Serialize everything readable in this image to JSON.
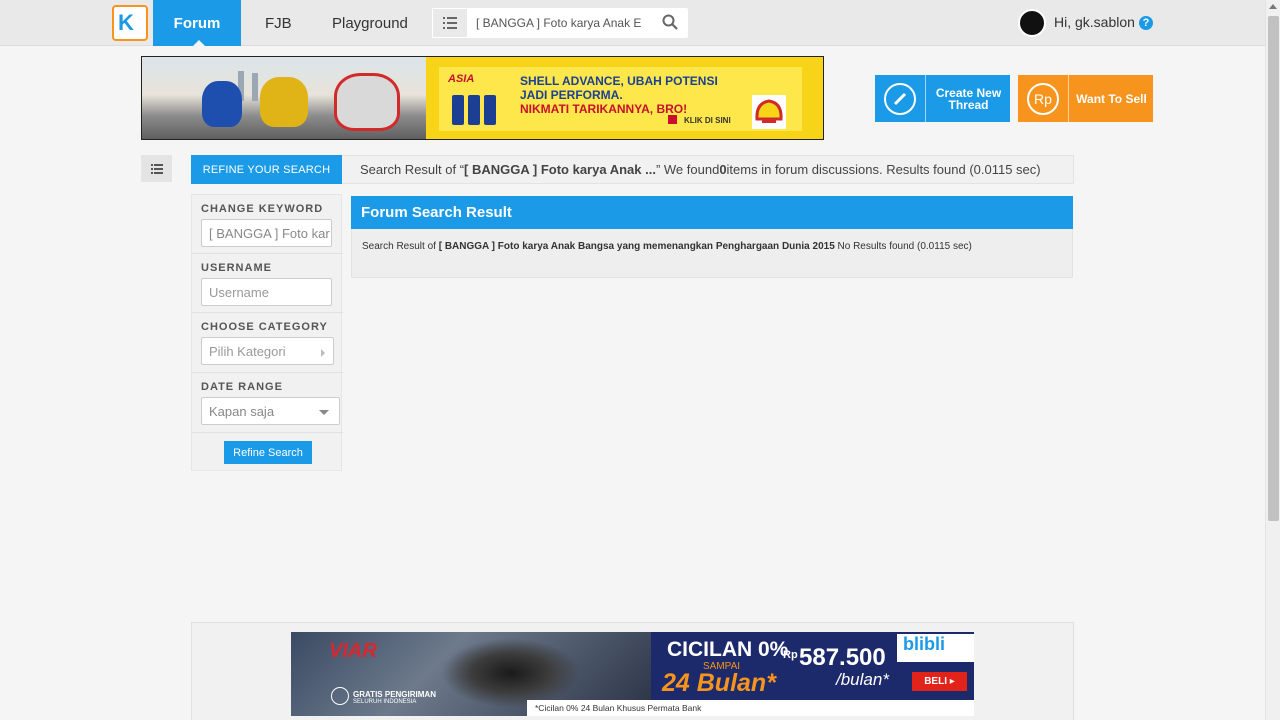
{
  "nav": {
    "logo_letter": "K",
    "forum": "Forum",
    "fjb": "FJB",
    "playground": "Playground",
    "search_value": "[ BANGGA ] Foto karya Anak E",
    "greeting": "Hi, gk.sablon",
    "help": "?"
  },
  "top_banner": {
    "cup_text": "ASIA",
    "line1": "SHELL ADVANCE, UBAH POTENSI",
    "line2": "JADI PERFORMA.",
    "line3": "NIKMATI TARIKANNYA, BRO!",
    "cta": "KLIK DI SINI"
  },
  "actions": {
    "create_label": "Create New Thread",
    "sell_label": "Want To Sell",
    "sell_icon": "Rp"
  },
  "refine_tab": "REFINE YOUR SEARCH",
  "result_summary": {
    "prefix": "Search Result of “",
    "keyword": "[ BANGGA ] Foto karya Anak ...",
    "mid": "” We found ",
    "count": "0",
    "suffix": " items in forum discussions. Results found (0.0115 sec)"
  },
  "sidebar": {
    "keyword_label": "CHANGE KEYWORD",
    "keyword_value": "[ BANGGA ] Foto kar",
    "username_label": "USERNAME",
    "username_placeholder": "Username",
    "category_label": "CHOOSE CATEGORY",
    "category_placeholder": "Pilih Kategori",
    "date_label": "DATE RANGE",
    "date_value": "Kapan saja",
    "refine_button": "Refine Search"
  },
  "forum_result": {
    "title": "Forum Search Result",
    "prefix": "Search Result of ",
    "keyword": "[ BANGGA ] Foto karya Anak Bangsa yang memenangkan Penghargaan Dunia 2015",
    "suffix": " No Results found (0.0115 sec)"
  },
  "bottom_banner": {
    "brand": "VIAR",
    "gratis": "GRATIS PENGIRIMAN",
    "gratis_sub": "SELURUH INDONESIA",
    "cicilan": "CICILAN 0%",
    "sampai": "SAMPAI",
    "months": "24 Bulan*",
    "rp": "Rp",
    "price": "587.500",
    "per": "/bulan*",
    "store": "blibli",
    "buy": "BELI",
    "footnote": "*Cicilan 0% 24 Bulan Khusus Permata Bank"
  },
  "colors": {
    "primary": "#1b9ae7",
    "accent": "#f7941d"
  }
}
